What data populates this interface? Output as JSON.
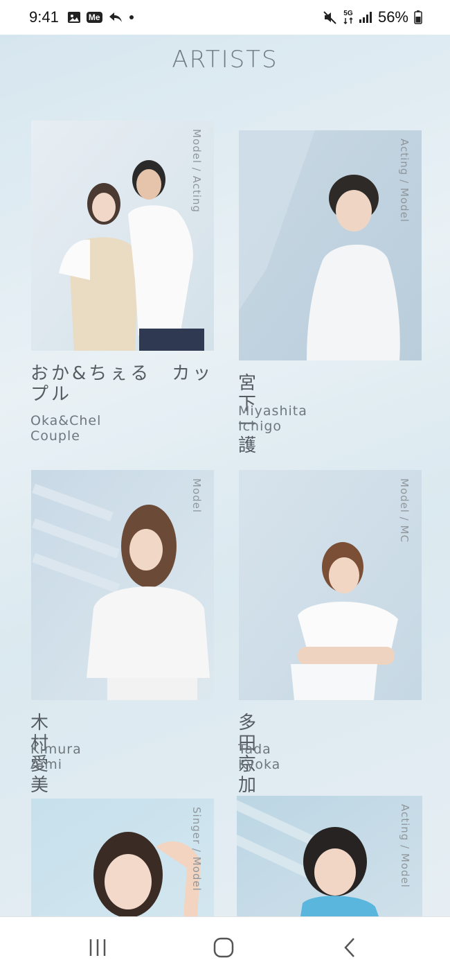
{
  "status_bar": {
    "time": "9:41",
    "me_badge": "Me",
    "network": "5G",
    "battery": "56%"
  },
  "page": {
    "title": "ARTISTS"
  },
  "artists": [
    {
      "role": "Model / Acting",
      "name_jp": "おか&ちぇる　カップル",
      "name_en": "Oka&Chel Couple"
    },
    {
      "role": "Acting / Model",
      "name_jp": "宮下一護",
      "name_en": "Miyashita Ichigo"
    },
    {
      "role": "Model",
      "name_jp": "木村愛美",
      "name_en": "Kimura Aimi"
    },
    {
      "role": "Model / MC",
      "name_jp": "多田京加",
      "name_en": "Tada Kyoka"
    },
    {
      "role": "Singer / Model",
      "name_jp": "",
      "name_en": ""
    },
    {
      "role": "Acting / Model",
      "name_jp": "",
      "name_en": ""
    }
  ],
  "icons": {
    "status": [
      "gallery-icon",
      "me-app-icon",
      "reply-icon",
      "notification-dot-icon",
      "mute-icon",
      "network-5g-icon",
      "signal-icon",
      "battery-icon"
    ],
    "nav": [
      "recent-apps-icon",
      "home-icon",
      "back-icon"
    ]
  },
  "colors": {
    "background": "#e6eff4",
    "title": "#6f7a82",
    "text": "#555d63"
  }
}
